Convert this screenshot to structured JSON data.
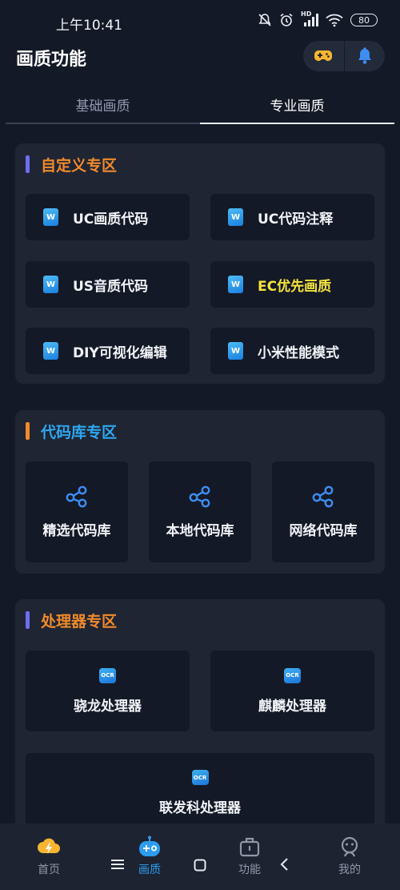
{
  "status_bar": {
    "time": "上午10:41",
    "battery": "80",
    "network_badge": "HD"
  },
  "header": {
    "title": "画质功能"
  },
  "tabs": [
    {
      "label": "基础画质",
      "active": false
    },
    {
      "label": "专业画质",
      "active": true
    }
  ],
  "sections": {
    "custom": {
      "title": "自定义专区",
      "bar_color": "#6e6ef0",
      "title_color": "#f08a2c",
      "items": [
        {
          "label": "UC画质代码"
        },
        {
          "label": "UC代码注释"
        },
        {
          "label": "US音质代码"
        },
        {
          "label": "EC优先画质",
          "highlight": "#f5e33c"
        },
        {
          "label": "DIY可视化编辑"
        },
        {
          "label": "小米性能模式"
        }
      ]
    },
    "library": {
      "title": "代码库专区",
      "bar_color": "#f08a2c",
      "title_color": "#2ea7f0",
      "items": [
        {
          "label": "精选代码库"
        },
        {
          "label": "本地代码库"
        },
        {
          "label": "网络代码库"
        }
      ]
    },
    "processor": {
      "title": "处理器专区",
      "bar_color": "#6e6ef0",
      "title_color": "#f08a2c",
      "items": [
        {
          "label": "骁龙处理器"
        },
        {
          "label": "麒麟处理器"
        },
        {
          "label": "联发科处理器"
        }
      ]
    }
  },
  "icons": {
    "doc": "W",
    "ocr": "OCR"
  },
  "bottom_nav": {
    "items": [
      {
        "label": "首页",
        "icon": "lightning-cloud-icon"
      },
      {
        "label": "画质",
        "icon": "gamepad-robot-icon",
        "active": true
      },
      {
        "label": "功能",
        "icon": "toolbox-icon"
      },
      {
        "label": "我的",
        "icon": "profile-icon"
      }
    ],
    "active_color": "#2e9cf0"
  }
}
